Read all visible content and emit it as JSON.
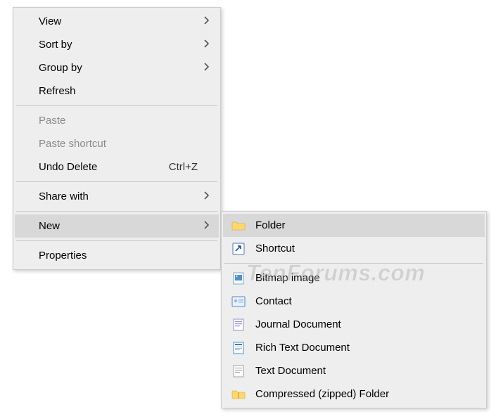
{
  "menu1": {
    "items": [
      {
        "label": "View",
        "hasSubmenu": true
      },
      {
        "label": "Sort by",
        "hasSubmenu": true
      },
      {
        "label": "Group by",
        "hasSubmenu": true
      },
      {
        "label": "Refresh"
      }
    ],
    "items2": [
      {
        "label": "Paste",
        "disabled": true
      },
      {
        "label": "Paste shortcut",
        "disabled": true
      },
      {
        "label": "Undo Delete",
        "shortcut": "Ctrl+Z"
      }
    ],
    "items3": [
      {
        "label": "Share with",
        "hasSubmenu": true
      }
    ],
    "items4": [
      {
        "label": "New",
        "hasSubmenu": true,
        "highlighted": true
      }
    ],
    "items5": [
      {
        "label": "Properties"
      }
    ]
  },
  "menu2": {
    "items": [
      {
        "label": "Folder",
        "highlighted": true,
        "icon": "folder"
      },
      {
        "label": "Shortcut",
        "icon": "shortcut"
      }
    ],
    "items2": [
      {
        "label": "Bitmap image",
        "icon": "bitmap"
      },
      {
        "label": "Contact",
        "icon": "contact"
      },
      {
        "label": "Journal Document",
        "icon": "journal"
      },
      {
        "label": "Rich Text Document",
        "icon": "rtf"
      },
      {
        "label": "Text Document",
        "icon": "text"
      },
      {
        "label": "Compressed (zipped) Folder",
        "icon": "zip"
      }
    ]
  },
  "watermark": "TenForums.com"
}
